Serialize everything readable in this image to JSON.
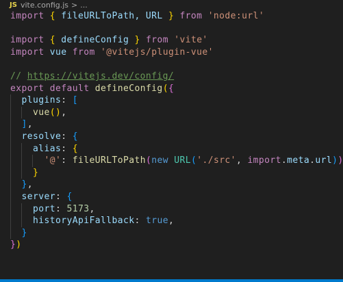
{
  "breadcrumb": {
    "badge": "JS",
    "file": "vite.config.js",
    "separator": ">",
    "ellipsis": "..."
  },
  "code": {
    "import_kw": "import",
    "from_kw": "from",
    "l1_names": "fileURLToPath, URL",
    "l1_source": "'node:url'",
    "l3_name": "defineConfig",
    "l3_source": "'vite'",
    "l4_name": "vue",
    "l4_source": "'@vitejs/plugin-vue'",
    "l6_comment_prefix": "// ",
    "l6_comment_url": "https://vitejs.dev/config/",
    "l7_export": "export",
    "l7_default": "default",
    "l7_fn": "defineConfig",
    "plugins_key": "plugins",
    "vue_call": "vue",
    "resolve_key": "resolve",
    "alias_key": "alias",
    "alias_name": "'@'",
    "file_fn": "fileURLToPath",
    "new_kw": "new",
    "url_cls": "URL",
    "src_path": "'./src'",
    "import_meta_import": "import",
    "import_meta_meta": "meta",
    "import_meta_url": "url",
    "server_key": "server",
    "port_key": "port",
    "port_value": "5173",
    "history_key": "historyApiFallback",
    "history_value": "true"
  },
  "colors": {
    "background": "#1f1f1f",
    "keyword": "#c586c0",
    "storage": "#569cd6",
    "function": "#dcdcaa",
    "variable": "#9cdcfe",
    "class": "#4ec9b0",
    "string": "#ce9178",
    "number": "#b5cea8",
    "comment": "#6a9955",
    "bracket_level1": "#ffd700",
    "bracket_level2": "#da70d6",
    "bracket_level3": "#179fff",
    "statusbar": "#007acc"
  }
}
